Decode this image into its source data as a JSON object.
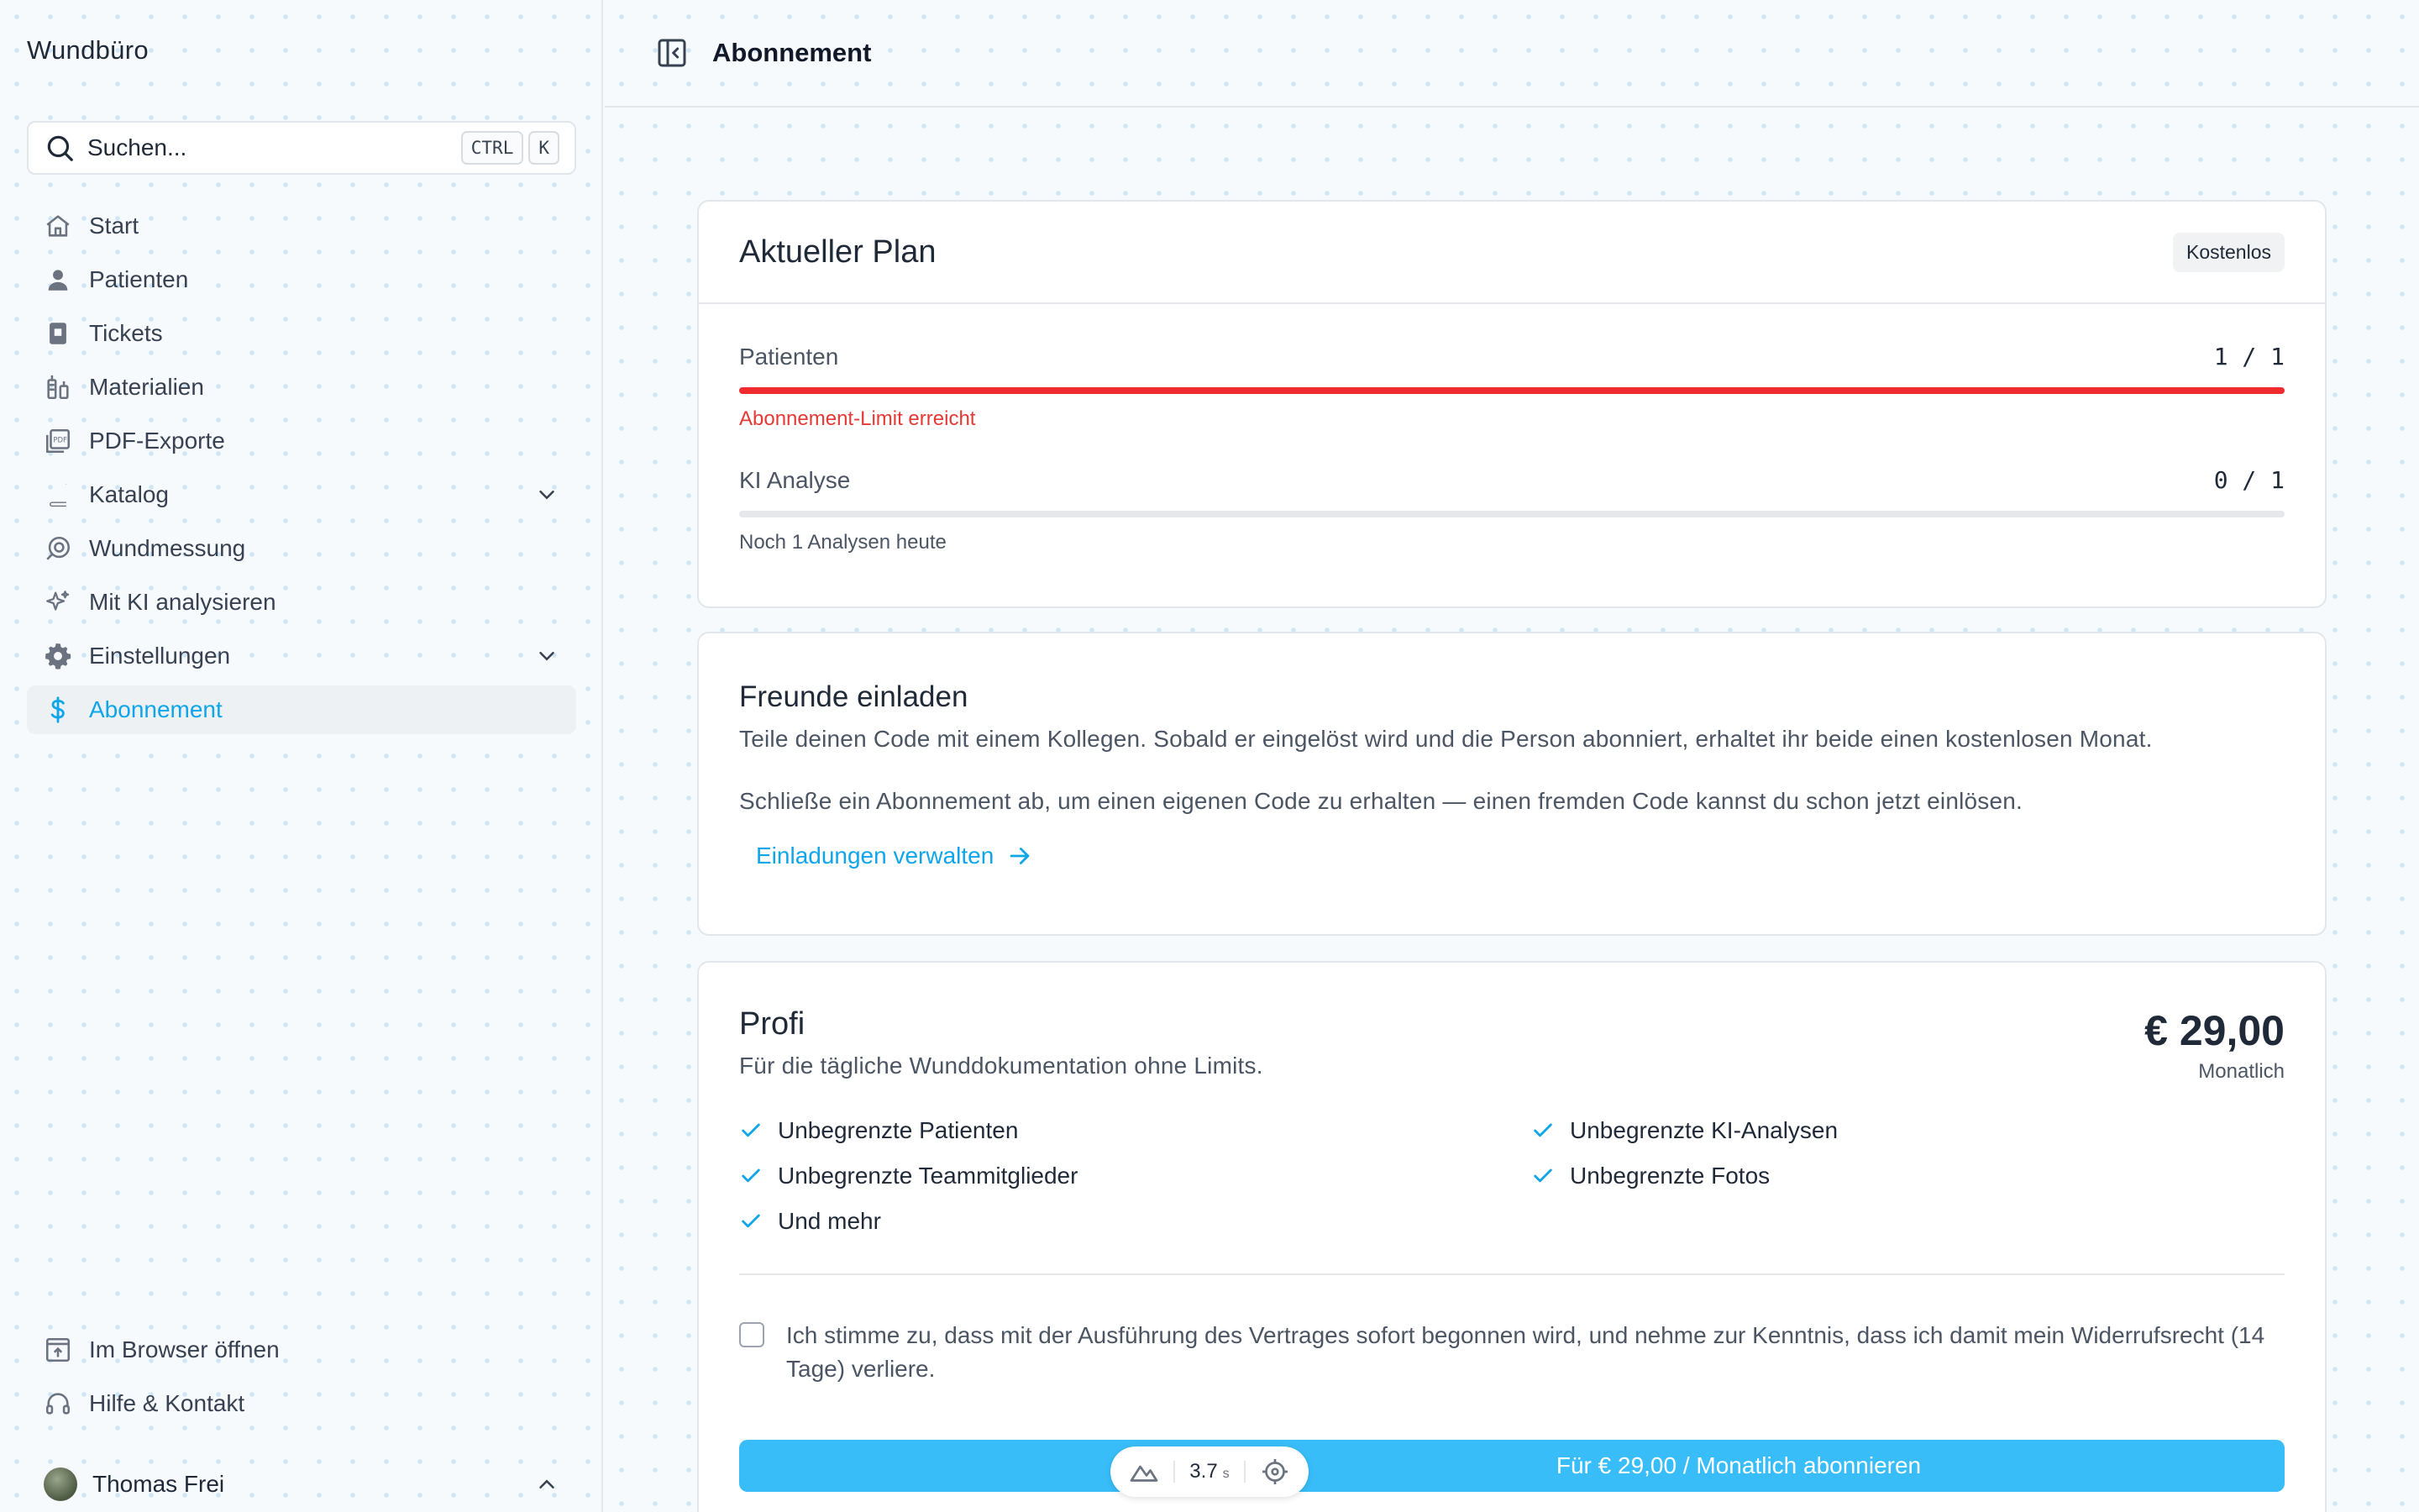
{
  "app": {
    "brand": "Wundbüro"
  },
  "search": {
    "placeholder": "Suchen...",
    "shortcut_ctrl": "CTRL",
    "shortcut_key": "K"
  },
  "sidebar": {
    "items": [
      {
        "label": "Start",
        "icon": "home-icon"
      },
      {
        "label": "Patienten",
        "icon": "user-icon"
      },
      {
        "label": "Tickets",
        "icon": "ticket-icon"
      },
      {
        "label": "Materialien",
        "icon": "materials-icon"
      },
      {
        "label": "PDF-Exporte",
        "icon": "pdf-icon"
      },
      {
        "label": "Katalog",
        "icon": "book-icon"
      },
      {
        "label": "Wundmessung",
        "icon": "measure-icon"
      },
      {
        "label": "Mit KI analysieren",
        "icon": "sparkle-icon"
      },
      {
        "label": "Einstellungen",
        "icon": "gear-icon"
      },
      {
        "label": "Abonnement",
        "icon": "dollar-icon"
      }
    ],
    "bottom": [
      {
        "label": "Im Browser öffnen",
        "icon": "external-icon"
      },
      {
        "label": "Hilfe & Kontakt",
        "icon": "headset-icon"
      }
    ],
    "user": {
      "name": "Thomas Frei"
    }
  },
  "header": {
    "title": "Abonnement"
  },
  "current_plan": {
    "title": "Aktueller Plan",
    "badge": "Kostenlos",
    "usage": [
      {
        "label": "Patienten",
        "value": "1 / 1",
        "fraction": 1.0,
        "note": "Abonnement-Limit erreicht",
        "note_color": "#e53935"
      },
      {
        "label": "KI Analyse",
        "value": "0 / 1",
        "fraction": 0.0,
        "note": "Noch 1 Analysen heute",
        "note_color": "#4b5563"
      }
    ]
  },
  "invite": {
    "title": "Freunde einladen",
    "text1": "Teile deinen Code mit einem Kollegen. Sobald er eingelöst wird und die Person abonniert, erhaltet ihr beide einen kostenlosen Monat.",
    "text2": "Schließe ein Abonnement ab, um einen eigenen Code zu erhalten — einen fremden Code kannst du schon jetzt einlösen.",
    "link": "Einladungen verwalten"
  },
  "plan": {
    "name": "Profi",
    "description": "Für die tägliche Wunddokumentation ohne Limits.",
    "price": "€ 29,00",
    "period": "Monatlich",
    "features": [
      "Unbegrenzte Patienten",
      "Unbegrenzte KI-Analysen",
      "Unbegrenzte Teammitglieder",
      "Unbegrenzte Fotos",
      "Und mehr"
    ],
    "consent": "Ich stimme zu, dass mit der Ausführung des Vertrages sofort begonnen wird, und nehme zur Kenntnis, dass ich damit mein Widerrufsrecht (14 Tage) verliere.",
    "subscribe": "Für € 29,00 / Monatlich abonnieren"
  },
  "overlay": {
    "value": "3.7",
    "unit": "s"
  },
  "colors": {
    "accent": "#0ea5e9",
    "button": "#38bdf8",
    "danger": "#ef2b2d"
  }
}
